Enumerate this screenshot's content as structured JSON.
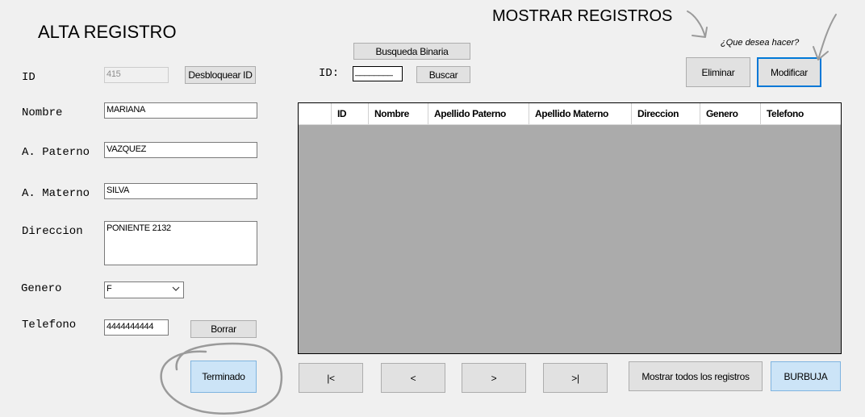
{
  "alta": {
    "title": "ALTA REGISTRO",
    "id_label": "ID",
    "id_value": "415",
    "unlock_button": "Desbloquear ID",
    "nombre_label": "Nombre",
    "nombre_value": "MARIANA",
    "paterno_label": "A. Paterno",
    "paterno_value": "VAZQUEZ",
    "materno_label": "A. Materno",
    "materno_value": "SILVA",
    "direccion_label": "Direccion",
    "direccion_value": "PONIENTE 2132",
    "genero_label": "Genero",
    "genero_value": "F",
    "telefono_label": "Telefono",
    "telefono_value": "4444444444",
    "borrar_button": "Borrar",
    "terminado_button": "Terminado"
  },
  "search": {
    "binary_button": "Busqueda Binaria",
    "id_label": "ID:",
    "id_value": "________",
    "buscar_button": "Buscar"
  },
  "mostrar": {
    "title": "MOSTRAR REGISTROS",
    "question": "¿Que desea hacer?",
    "eliminar_button": "Eliminar",
    "modificar_button": "Modificar"
  },
  "grid": {
    "columns": [
      "ID",
      "Nombre",
      "Apellido Paterno",
      "Apellido Materno",
      "Direccion",
      "Genero",
      "Telefono"
    ]
  },
  "nav": {
    "first": "|<",
    "prev": "<",
    "next": ">",
    "last": ">|",
    "show_all": "Mostrar todos los registros",
    "bubble": "BURBUJA"
  },
  "colors": {
    "background": "#f0f0f0",
    "grid_background": "#ababab",
    "highlight_button": "#cce4f7",
    "focus_border": "#0078d7"
  }
}
